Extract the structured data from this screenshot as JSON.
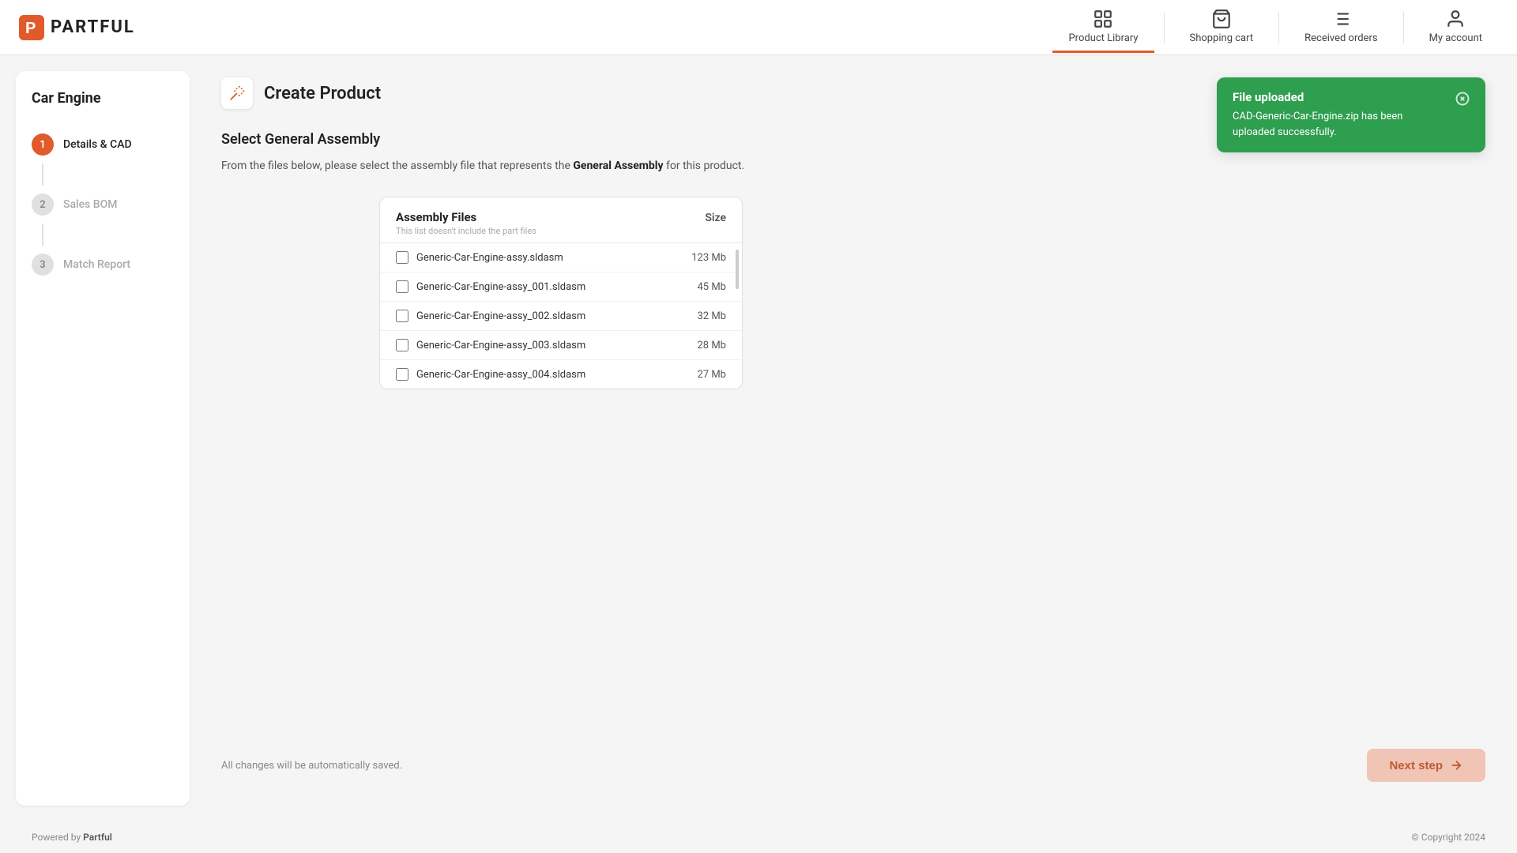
{
  "header": {
    "logo_text": "PARTFUL",
    "nav_items": [
      {
        "id": "product-library",
        "label": "Product Library",
        "active": true
      },
      {
        "id": "shopping-cart",
        "label": "Shopping cart",
        "active": false
      },
      {
        "id": "received-orders",
        "label": "Received orders",
        "active": false
      },
      {
        "id": "my-account",
        "label": "My account",
        "active": false
      }
    ]
  },
  "sidebar": {
    "title": "Car Engine",
    "steps": [
      {
        "number": "1",
        "label": "Details & CAD",
        "state": "active"
      },
      {
        "number": "2",
        "label": "Sales BOM",
        "state": "inactive"
      },
      {
        "number": "3",
        "label": "Match Report",
        "state": "inactive"
      }
    ]
  },
  "page": {
    "title": "Create Product",
    "section_title": "Select General Assembly",
    "section_desc_prefix": "From the files below, please select the assembly file that represents the ",
    "section_desc_bold": "General Assembly",
    "section_desc_suffix": " for this product."
  },
  "assembly_table": {
    "title": "Assembly Files",
    "subtitle": "This list doesn't include the part files",
    "col_size": "Size",
    "files": [
      {
        "name": "Generic-Car-Engine-assy.sldasm",
        "size": "123 Mb"
      },
      {
        "name": "Generic-Car-Engine-assy_001.sldasm",
        "size": "45 Mb"
      },
      {
        "name": "Generic-Car-Engine-assy_002.sldasm",
        "size": "32 Mb"
      },
      {
        "name": "Generic-Car-Engine-assy_003.sldasm",
        "size": "28 Mb"
      },
      {
        "name": "Generic-Car-Engine-assy_004.sldasm",
        "size": "27 Mb"
      }
    ]
  },
  "notification": {
    "title": "File uploaded",
    "body": "CAD-Generic-Car-Engine.zip has been uploaded successfully."
  },
  "bottom": {
    "autosave": "All changes will be automatically saved.",
    "next_step_label": "Next step"
  },
  "footer": {
    "powered_by": "Powered by ",
    "brand": "Partful",
    "copyright": "© Copyright 2024"
  }
}
